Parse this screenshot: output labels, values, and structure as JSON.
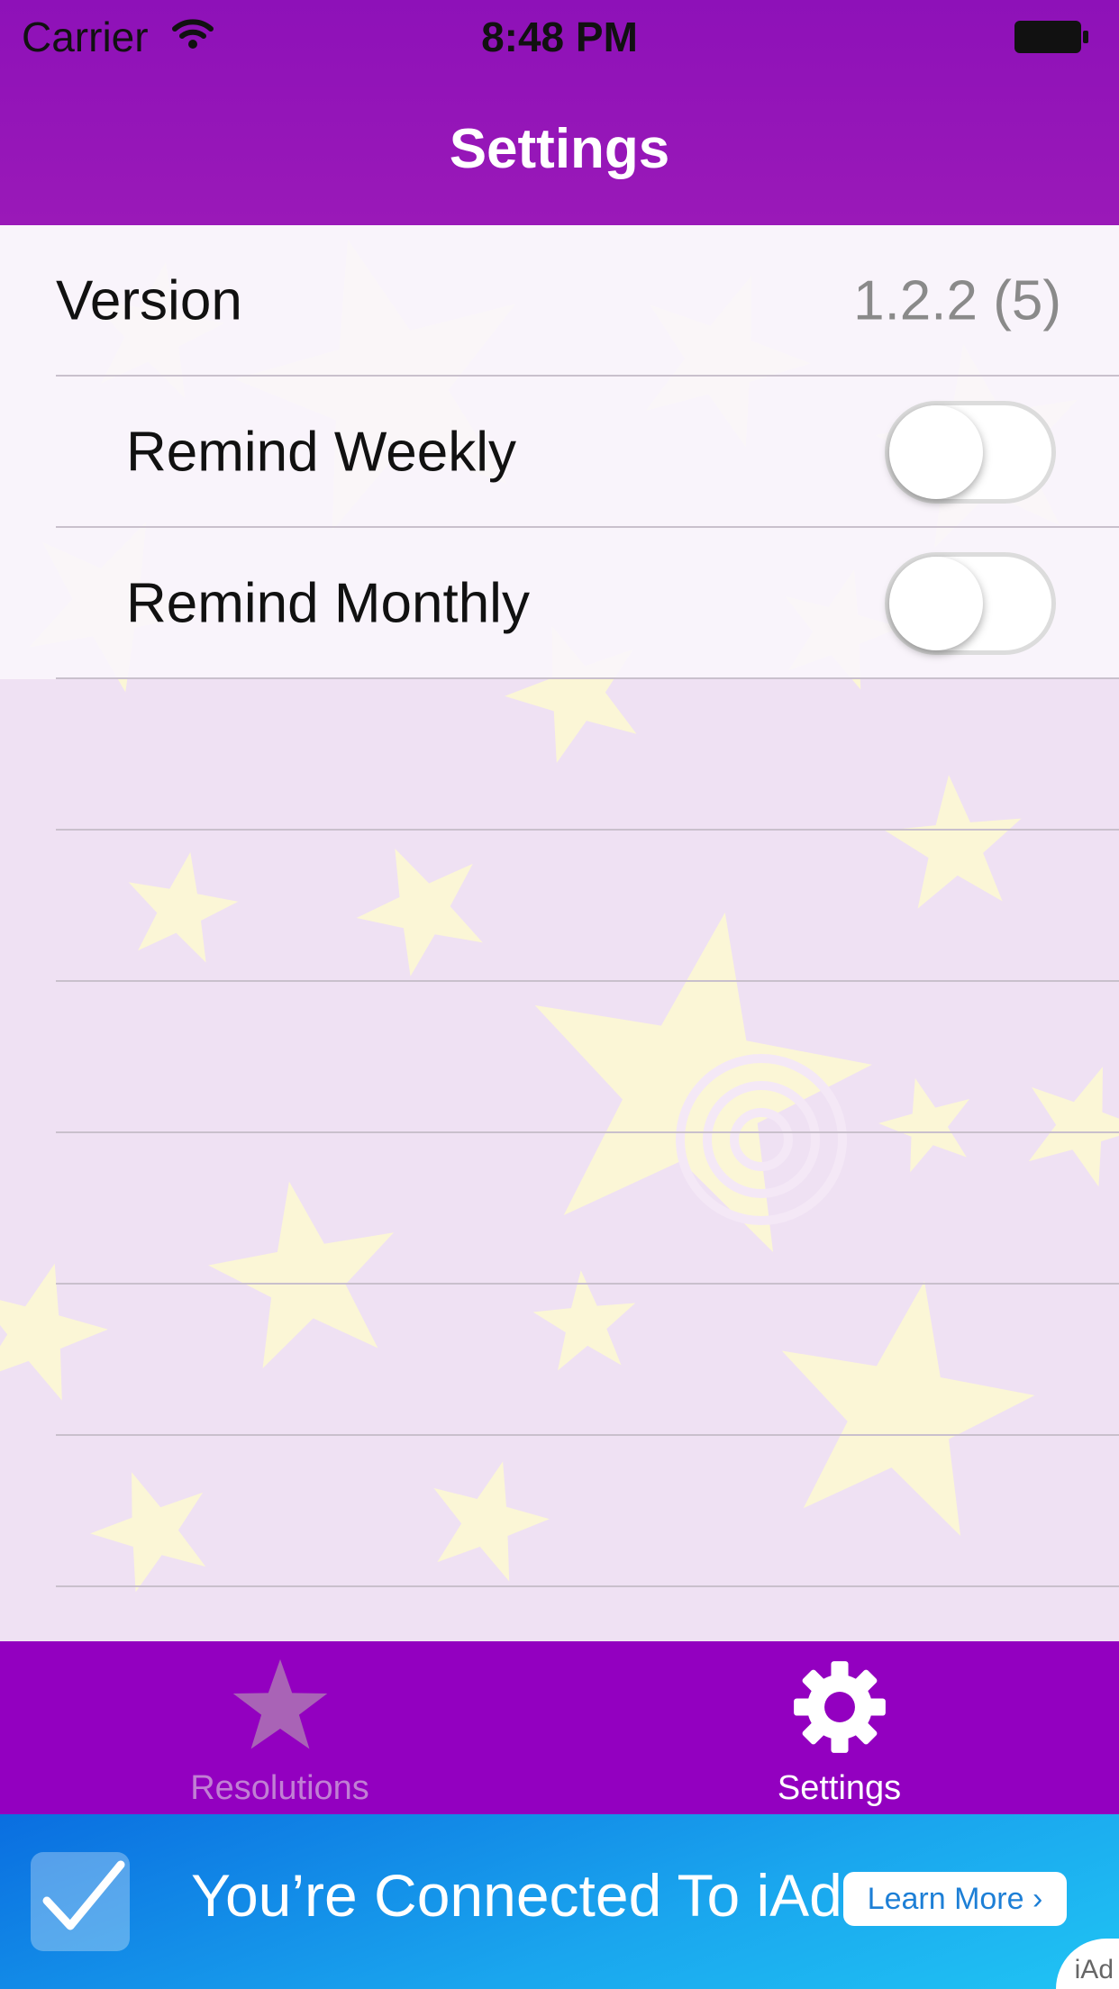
{
  "status_bar": {
    "carrier": "Carrier",
    "time": "8:48 PM"
  },
  "nav": {
    "title": "Settings"
  },
  "settings": {
    "version": {
      "label": "Version",
      "value": "1.2.2 (5)"
    },
    "remind_weekly": {
      "label": "Remind Weekly",
      "on": false
    },
    "remind_monthly": {
      "label": "Remind Monthly",
      "on": false
    }
  },
  "tab_bar": {
    "tabs": [
      {
        "label": "Resolutions",
        "icon": "star-icon",
        "selected": false
      },
      {
        "label": "Settings",
        "icon": "gear-icon",
        "selected": true
      }
    ]
  },
  "ad": {
    "text": "You’re Connected To iAd",
    "button": "Learn More ›",
    "badge": "iAd"
  },
  "colors": {
    "nav_purple": "#8e11b8",
    "tab_purple": "#9300c0",
    "ad_blue": "#1aa6ee"
  }
}
